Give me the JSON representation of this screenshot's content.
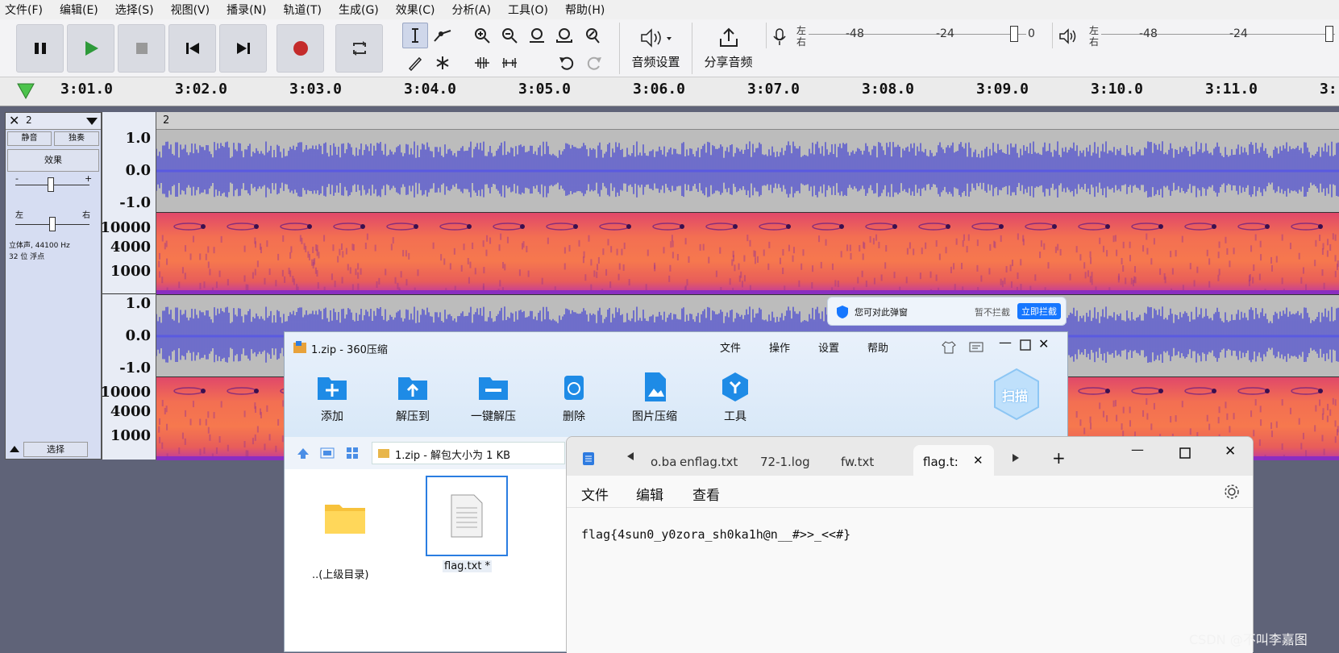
{
  "menu": [
    "文件(F)",
    "编辑(E)",
    "选择(S)",
    "视图(V)",
    "播录(N)",
    "轨道(T)",
    "生成(G)",
    "效果(C)",
    "分析(A)",
    "工具(O)",
    "帮助(H)"
  ],
  "toolbar": {
    "audio_setup": "音频设置",
    "share_audio": "分享音频",
    "rec_meter": {
      "left": "左",
      "right": "右",
      "t1": "-48",
      "t2": "-24",
      "t3": "0"
    },
    "play_meter": {
      "left": "左",
      "right": "右",
      "t1": "-48",
      "t2": "-24"
    }
  },
  "timeline": [
    "3:01.0",
    "3:02.0",
    "3:03.0",
    "3:04.0",
    "3:05.0",
    "3:06.0",
    "3:07.0",
    "3:08.0",
    "3:09.0",
    "3:10.0",
    "3:11.0",
    "3:"
  ],
  "track": {
    "name": "2",
    "clip_name": "2",
    "mute": "静音",
    "solo": "独奏",
    "effects": "效果",
    "gain_minus": "-",
    "gain_plus": "+",
    "pan_left": "左",
    "pan_right": "右",
    "info1": "立体声, 44100 Hz",
    "info2": "32 位 浮点",
    "select": "选择"
  },
  "ruler": {
    "wave": [
      "1.0",
      "0.0",
      "-1.0"
    ],
    "spec": [
      "10000",
      "4000",
      "1000"
    ]
  },
  "colors": {
    "wave": "#3c3bd4",
    "accent": "#1677ff"
  },
  "popup": {
    "text": "您可对此弹窗",
    "ignore": "暂不拦截",
    "block": "立即拦截"
  },
  "zip": {
    "title": "1.zip - 360压缩",
    "menu": [
      "文件",
      "操作",
      "设置",
      "帮助"
    ],
    "tools": [
      "添加",
      "解压到",
      "一键解压",
      "删除",
      "图片压缩",
      "工具"
    ],
    "scan": "扫描",
    "address": "1.zip - 解包大小为 1 KB",
    "files": [
      "..(上级目录)",
      "flag.txt *"
    ]
  },
  "notepad": {
    "tabs": [
      "o.ba",
      "enflag.txt",
      "72-1.log",
      "fw.txt",
      "flag.t:"
    ],
    "menu": [
      "文件",
      "编辑",
      "查看"
    ],
    "content": "flag{4sun0_y0zora_sh0ka1h@n__#>>_<<#}"
  },
  "watermark": "CSDN @不叫李嘉图"
}
